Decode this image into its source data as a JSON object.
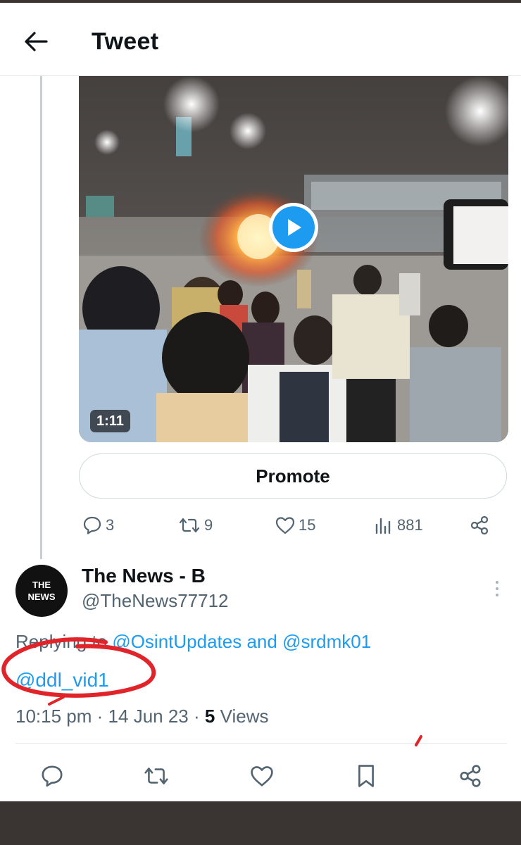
{
  "header": {
    "title": "Tweet",
    "back_icon": "arrow-left-icon"
  },
  "media": {
    "duration": "1:11",
    "play_icon": "play-icon",
    "accent_color": "#1d9bf0"
  },
  "promote": {
    "label": "Promote"
  },
  "actions": {
    "replies": "3",
    "retweets": "9",
    "likes": "15",
    "views": "881"
  },
  "reply_tweet": {
    "avatar_line1": "THE",
    "avatar_line2": "NEWS",
    "display_name": "The News - B",
    "handle": "@TheNews77712",
    "replying_prefix": "Replying to",
    "mention1": "@OsintUpdates",
    "and_text": "and",
    "mention2": "@srdmk01",
    "mention3": "@ddl_vid1",
    "time": "10:15 pm",
    "date": "14 Jun 23",
    "views_count": "5",
    "views_label": "Views"
  },
  "bottom_actions": [
    "reply-icon",
    "retweet-icon",
    "like-icon",
    "bookmark-icon",
    "share-icon"
  ],
  "colors": {
    "link": "#1d9bf0",
    "secondary_text": "#536471",
    "annotation_red": "#e0242a"
  }
}
